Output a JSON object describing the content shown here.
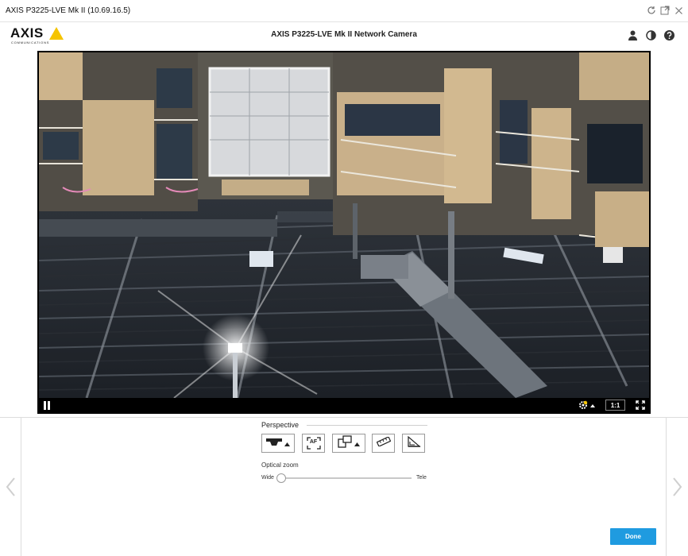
{
  "window": {
    "title": "AXIS P3225-LVE Mk II (10.69.16.5)",
    "icons": [
      "refresh-icon",
      "popout-icon",
      "close-icon"
    ]
  },
  "header": {
    "logo_text": "AXIS",
    "logo_subtext": "COMMUNICATIONS",
    "title": "AXIS P3225-LVE Mk II Network Camera",
    "icons": [
      "user-icon",
      "contrast-icon",
      "help-icon"
    ]
  },
  "video": {
    "scale_label": "1:1",
    "controls": [
      "pause-icon",
      "snapshot-settings-icon",
      "fullscreen-icon"
    ]
  },
  "perspective": {
    "title": "Perspective",
    "tools": [
      "mounting-position-icon",
      "autofocus-icon",
      "orientation-icon",
      "straighten-icon",
      "level-icon"
    ],
    "autofocus_text": "AF"
  },
  "optical_zoom": {
    "label": "Optical zoom",
    "min_label": "Wide",
    "max_label": "Tele",
    "value_fraction": 0.0
  },
  "actions": {
    "done_label": "Done"
  },
  "colors": {
    "accent": "#1f9be0",
    "logo_yellow": "#f5c400"
  }
}
